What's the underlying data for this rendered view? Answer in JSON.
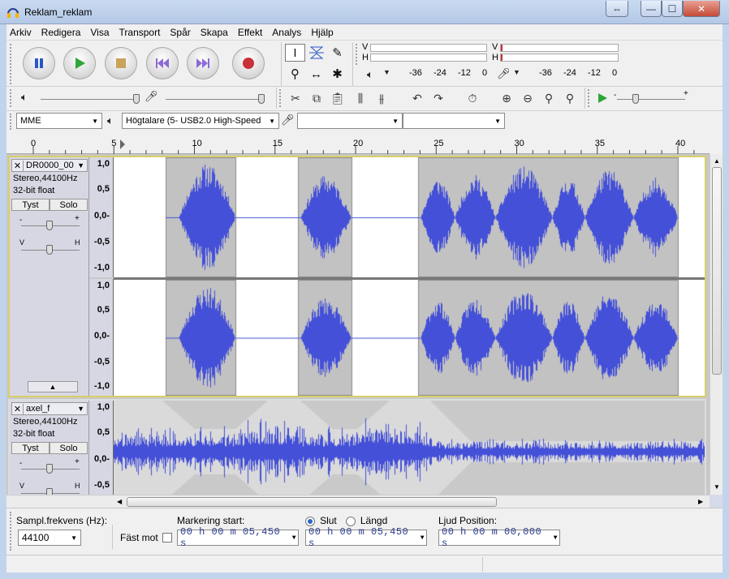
{
  "window": {
    "title": "Reklam_reklam",
    "restore_extra": "⇔",
    "minimize": "—",
    "maximize": "☐",
    "close": "✕"
  },
  "menu": [
    "Arkiv",
    "Redigera",
    "Visa",
    "Transport",
    "Spår",
    "Skapa",
    "Effekt",
    "Analys",
    "Hjälp"
  ],
  "meters": {
    "playback_channels": [
      "V",
      "H"
    ],
    "record_channels": [
      "V",
      "H"
    ],
    "playback_scale": [
      "-36",
      "-24",
      "-12",
      "0"
    ],
    "record_scale": [
      "-36",
      "-24",
      "-12",
      "0"
    ]
  },
  "device": {
    "host": "MME",
    "output": "Högtalare (5- USB2.0 High-Speed",
    "input": "",
    "channels": ""
  },
  "ruler": {
    "labels": [
      "0",
      "5",
      "10",
      "15",
      "20",
      "25",
      "30",
      "35",
      "40"
    ],
    "label_values": [
      0,
      5,
      10,
      15,
      20,
      25,
      30,
      35,
      40
    ]
  },
  "tracks": [
    {
      "name": "DR0000_00",
      "format": "Stereo,44100Hz",
      "bitdepth": "32-bit float",
      "mute": "Tyst",
      "solo": "Solo",
      "gain_minus": "-",
      "gain_plus": "+",
      "pan_left": "V",
      "pan_right": "H",
      "scale_ch1": [
        "1,0",
        "0,5",
        "0,0-",
        "-0,5",
        "-1,0"
      ],
      "scale_ch2": [
        "1,0",
        "0,5",
        "0,0-",
        "-0,5",
        "-1,0"
      ]
    },
    {
      "name": "axel_f",
      "format": "Stereo,44100Hz",
      "bitdepth": "32-bit float",
      "mute": "Tyst",
      "solo": "Solo",
      "gain_minus": "-",
      "gain_plus": "+",
      "pan_left": "V",
      "pan_right": "H",
      "scale_ch1": [
        "1,0",
        "0,5",
        "0,0-",
        "-0,5"
      ]
    }
  ],
  "selection": {
    "rate_label": "Sampl.frekvens (Hz):",
    "rate_value": "44100",
    "snap_label": "Fäst mot",
    "start_label": "Markering start:",
    "end_label": "Slut",
    "length_label": "Längd",
    "position_label": "Ljud Position:",
    "start_time": "00 h 00 m 05,450 s",
    "end_time": "00 h 00 m 05,450 s",
    "position_time": "00 h 00 m 00,000 s"
  }
}
